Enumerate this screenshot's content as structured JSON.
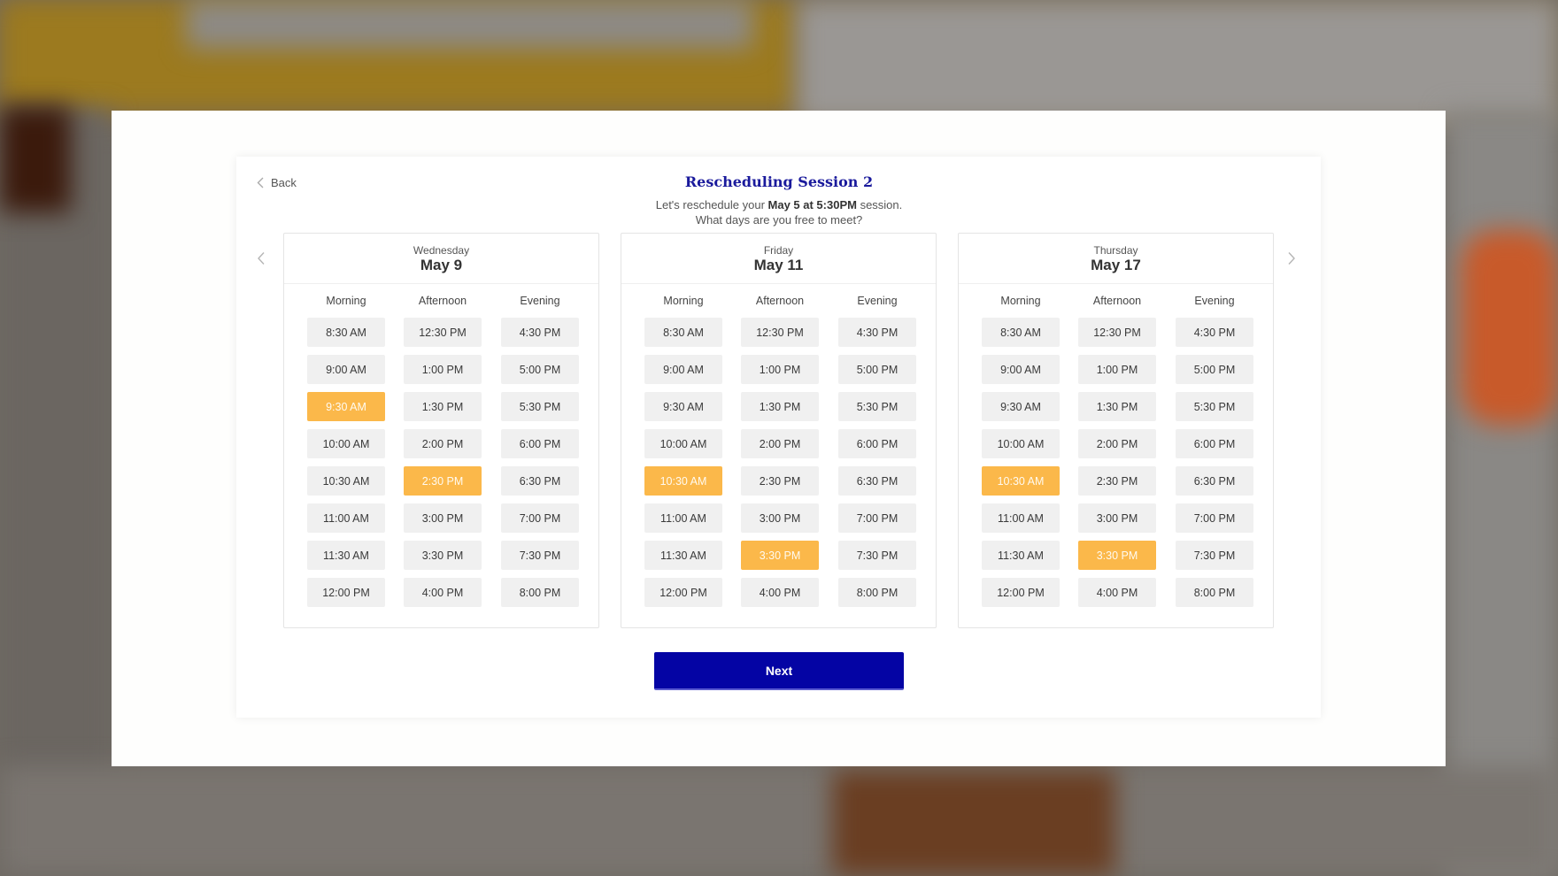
{
  "header": {
    "back_label": "Back",
    "title": "Rescheduling Session 2",
    "subtitle_prefix": "Let's reschedule your ",
    "subtitle_bold": "May 5 at 5:30PM",
    "subtitle_suffix": " session.",
    "subtitle_line2": "What days are you free to meet?"
  },
  "icons": {
    "back": "chevron-left-icon",
    "prev": "chevron-left-icon",
    "next": "chevron-right-icon"
  },
  "colors": {
    "title": "#1a1a9c",
    "selected_slot": "#fbb84a",
    "slot": "#f0f0f0",
    "next_button": "#0404a4"
  },
  "periods": [
    "Morning",
    "Afternoon",
    "Evening"
  ],
  "days": [
    {
      "weekday": "Wednesday",
      "date": "May 9",
      "columns": [
        [
          "8:30 AM",
          "9:00 AM",
          "9:30 AM",
          "10:00 AM",
          "10:30 AM",
          "11:00 AM",
          "11:30 AM",
          "12:00 PM"
        ],
        [
          "12:30 PM",
          "1:00 PM",
          "1:30 PM",
          "2:00 PM",
          "2:30 PM",
          "3:00 PM",
          "3:30 PM",
          "4:00 PM"
        ],
        [
          "4:30 PM",
          "5:00 PM",
          "5:30 PM",
          "6:00 PM",
          "6:30 PM",
          "7:00 PM",
          "7:30 PM",
          "8:00 PM"
        ]
      ],
      "selected": [
        "9:30 AM",
        "2:30 PM"
      ]
    },
    {
      "weekday": "Friday",
      "date": "May 11",
      "columns": [
        [
          "8:30 AM",
          "9:00 AM",
          "9:30 AM",
          "10:00 AM",
          "10:30 AM",
          "11:00 AM",
          "11:30 AM",
          "12:00 PM"
        ],
        [
          "12:30 PM",
          "1:00 PM",
          "1:30 PM",
          "2:00 PM",
          "2:30 PM",
          "3:00 PM",
          "3:30 PM",
          "4:00 PM"
        ],
        [
          "4:30 PM",
          "5:00 PM",
          "5:30 PM",
          "6:00 PM",
          "6:30 PM",
          "7:00 PM",
          "7:30 PM",
          "8:00 PM"
        ]
      ],
      "selected": [
        "10:30 AM",
        "3:30 PM"
      ]
    },
    {
      "weekday": "Thursday",
      "date": "May 17",
      "columns": [
        [
          "8:30 AM",
          "9:00 AM",
          "9:30 AM",
          "10:00 AM",
          "10:30 AM",
          "11:00 AM",
          "11:30 AM",
          "12:00 PM"
        ],
        [
          "12:30 PM",
          "1:00 PM",
          "1:30 PM",
          "2:00 PM",
          "2:30 PM",
          "3:00 PM",
          "3:30 PM",
          "4:00 PM"
        ],
        [
          "4:30 PM",
          "5:00 PM",
          "5:30 PM",
          "6:00 PM",
          "6:30 PM",
          "7:00 PM",
          "7:30 PM",
          "8:00 PM"
        ]
      ],
      "selected": [
        "10:30 AM",
        "3:30 PM"
      ]
    }
  ],
  "footer": {
    "next_label": "Next"
  }
}
